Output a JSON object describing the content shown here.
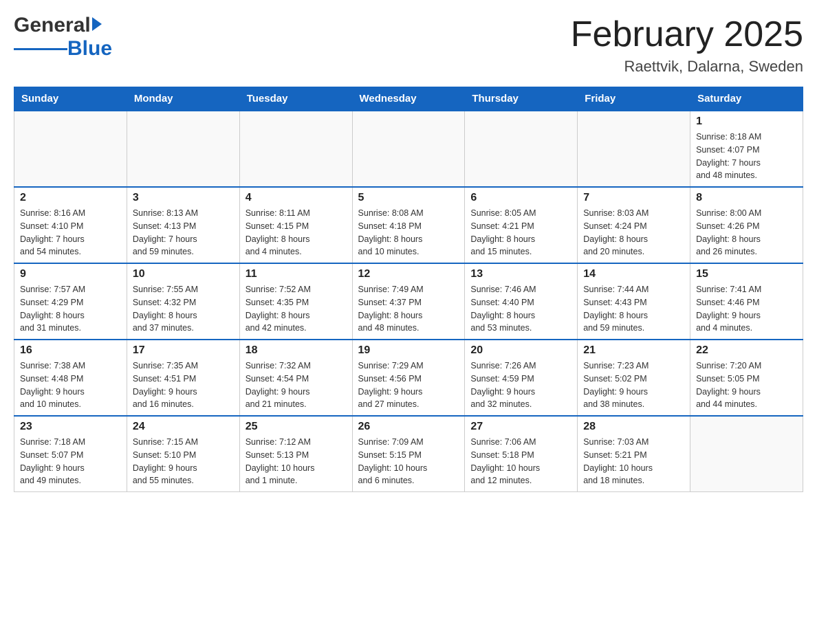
{
  "header": {
    "logo_general": "General",
    "logo_blue": "Blue",
    "title": "February 2025",
    "subtitle": "Raettvik, Dalarna, Sweden"
  },
  "days_of_week": [
    "Sunday",
    "Monday",
    "Tuesday",
    "Wednesday",
    "Thursday",
    "Friday",
    "Saturday"
  ],
  "weeks": [
    {
      "days": [
        {
          "num": "",
          "info": ""
        },
        {
          "num": "",
          "info": ""
        },
        {
          "num": "",
          "info": ""
        },
        {
          "num": "",
          "info": ""
        },
        {
          "num": "",
          "info": ""
        },
        {
          "num": "",
          "info": ""
        },
        {
          "num": "1",
          "info": "Sunrise: 8:18 AM\nSunset: 4:07 PM\nDaylight: 7 hours\nand 48 minutes."
        }
      ]
    },
    {
      "days": [
        {
          "num": "2",
          "info": "Sunrise: 8:16 AM\nSunset: 4:10 PM\nDaylight: 7 hours\nand 54 minutes."
        },
        {
          "num": "3",
          "info": "Sunrise: 8:13 AM\nSunset: 4:13 PM\nDaylight: 7 hours\nand 59 minutes."
        },
        {
          "num": "4",
          "info": "Sunrise: 8:11 AM\nSunset: 4:15 PM\nDaylight: 8 hours\nand 4 minutes."
        },
        {
          "num": "5",
          "info": "Sunrise: 8:08 AM\nSunset: 4:18 PM\nDaylight: 8 hours\nand 10 minutes."
        },
        {
          "num": "6",
          "info": "Sunrise: 8:05 AM\nSunset: 4:21 PM\nDaylight: 8 hours\nand 15 minutes."
        },
        {
          "num": "7",
          "info": "Sunrise: 8:03 AM\nSunset: 4:24 PM\nDaylight: 8 hours\nand 20 minutes."
        },
        {
          "num": "8",
          "info": "Sunrise: 8:00 AM\nSunset: 4:26 PM\nDaylight: 8 hours\nand 26 minutes."
        }
      ]
    },
    {
      "days": [
        {
          "num": "9",
          "info": "Sunrise: 7:57 AM\nSunset: 4:29 PM\nDaylight: 8 hours\nand 31 minutes."
        },
        {
          "num": "10",
          "info": "Sunrise: 7:55 AM\nSunset: 4:32 PM\nDaylight: 8 hours\nand 37 minutes."
        },
        {
          "num": "11",
          "info": "Sunrise: 7:52 AM\nSunset: 4:35 PM\nDaylight: 8 hours\nand 42 minutes."
        },
        {
          "num": "12",
          "info": "Sunrise: 7:49 AM\nSunset: 4:37 PM\nDaylight: 8 hours\nand 48 minutes."
        },
        {
          "num": "13",
          "info": "Sunrise: 7:46 AM\nSunset: 4:40 PM\nDaylight: 8 hours\nand 53 minutes."
        },
        {
          "num": "14",
          "info": "Sunrise: 7:44 AM\nSunset: 4:43 PM\nDaylight: 8 hours\nand 59 minutes."
        },
        {
          "num": "15",
          "info": "Sunrise: 7:41 AM\nSunset: 4:46 PM\nDaylight: 9 hours\nand 4 minutes."
        }
      ]
    },
    {
      "days": [
        {
          "num": "16",
          "info": "Sunrise: 7:38 AM\nSunset: 4:48 PM\nDaylight: 9 hours\nand 10 minutes."
        },
        {
          "num": "17",
          "info": "Sunrise: 7:35 AM\nSunset: 4:51 PM\nDaylight: 9 hours\nand 16 minutes."
        },
        {
          "num": "18",
          "info": "Sunrise: 7:32 AM\nSunset: 4:54 PM\nDaylight: 9 hours\nand 21 minutes."
        },
        {
          "num": "19",
          "info": "Sunrise: 7:29 AM\nSunset: 4:56 PM\nDaylight: 9 hours\nand 27 minutes."
        },
        {
          "num": "20",
          "info": "Sunrise: 7:26 AM\nSunset: 4:59 PM\nDaylight: 9 hours\nand 32 minutes."
        },
        {
          "num": "21",
          "info": "Sunrise: 7:23 AM\nSunset: 5:02 PM\nDaylight: 9 hours\nand 38 minutes."
        },
        {
          "num": "22",
          "info": "Sunrise: 7:20 AM\nSunset: 5:05 PM\nDaylight: 9 hours\nand 44 minutes."
        }
      ]
    },
    {
      "days": [
        {
          "num": "23",
          "info": "Sunrise: 7:18 AM\nSunset: 5:07 PM\nDaylight: 9 hours\nand 49 minutes."
        },
        {
          "num": "24",
          "info": "Sunrise: 7:15 AM\nSunset: 5:10 PM\nDaylight: 9 hours\nand 55 minutes."
        },
        {
          "num": "25",
          "info": "Sunrise: 7:12 AM\nSunset: 5:13 PM\nDaylight: 10 hours\nand 1 minute."
        },
        {
          "num": "26",
          "info": "Sunrise: 7:09 AM\nSunset: 5:15 PM\nDaylight: 10 hours\nand 6 minutes."
        },
        {
          "num": "27",
          "info": "Sunrise: 7:06 AM\nSunset: 5:18 PM\nDaylight: 10 hours\nand 12 minutes."
        },
        {
          "num": "28",
          "info": "Sunrise: 7:03 AM\nSunset: 5:21 PM\nDaylight: 10 hours\nand 18 minutes."
        },
        {
          "num": "",
          "info": ""
        }
      ]
    }
  ]
}
